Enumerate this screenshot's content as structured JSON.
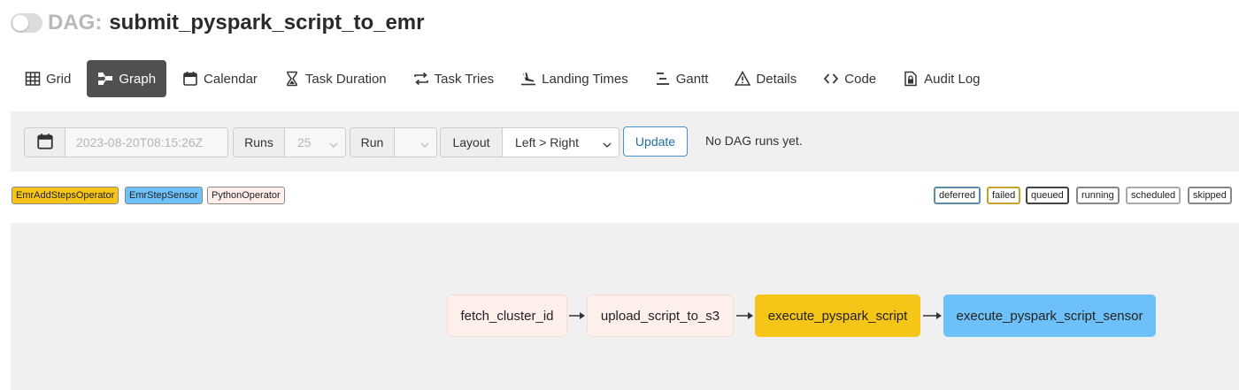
{
  "header": {
    "prefix": "DAG:",
    "dag_id": "submit_pyspark_script_to_emr",
    "paused": true
  },
  "tabs": [
    {
      "label": "Grid",
      "icon": "grid-icon",
      "active": false
    },
    {
      "label": "Graph",
      "icon": "graph-icon",
      "active": true
    },
    {
      "label": "Calendar",
      "icon": "calendar-icon",
      "active": false
    },
    {
      "label": "Task Duration",
      "icon": "hourglass-icon",
      "active": false
    },
    {
      "label": "Task Tries",
      "icon": "retry-icon",
      "active": false
    },
    {
      "label": "Landing Times",
      "icon": "landing-icon",
      "active": false
    },
    {
      "label": "Gantt",
      "icon": "gantt-icon",
      "active": false
    },
    {
      "label": "Details",
      "icon": "warning-triangle-icon",
      "active": false
    },
    {
      "label": "Code",
      "icon": "code-icon",
      "active": false
    },
    {
      "label": "Audit Log",
      "icon": "file-lock-icon",
      "active": false
    }
  ],
  "filters": {
    "date_value": "2023-08-20T08:15:26Z",
    "runs_label": "Runs",
    "runs_value": "25",
    "run_label": "Run",
    "run_value": "",
    "layout_label": "Layout",
    "layout_value": "Left > Right",
    "update_label": "Update",
    "status_text": "No DAG runs yet."
  },
  "operators": [
    {
      "label": "EmrAddStepsOperator",
      "color": "#f5c518"
    },
    {
      "label": "EmrStepSensor",
      "color": "#6ec1f8"
    },
    {
      "label": "PythonOperator",
      "color": "#ffefeb"
    }
  ],
  "states": [
    {
      "label": "deferred",
      "color": "#5a8fa8"
    },
    {
      "label": "failed",
      "color": "#c9a227"
    },
    {
      "label": "queued",
      "color": "#444444"
    },
    {
      "label": "running",
      "color": "#888888"
    },
    {
      "label": "scheduled",
      "color": "#aaaaaa"
    },
    {
      "label": "skipped",
      "color": "#888888"
    }
  ],
  "tasks": [
    {
      "task_id": "fetch_cluster_id",
      "operator": "PythonOperator",
      "color": "#ffefeb"
    },
    {
      "task_id": "upload_script_to_s3",
      "operator": "PythonOperator",
      "color": "#ffefeb"
    },
    {
      "task_id": "execute_pyspark_script",
      "operator": "EmrAddStepsOperator",
      "color": "#f5c518"
    },
    {
      "task_id": "execute_pyspark_script_sensor",
      "operator": "EmrStepSensor",
      "color": "#6ec1f8"
    }
  ]
}
